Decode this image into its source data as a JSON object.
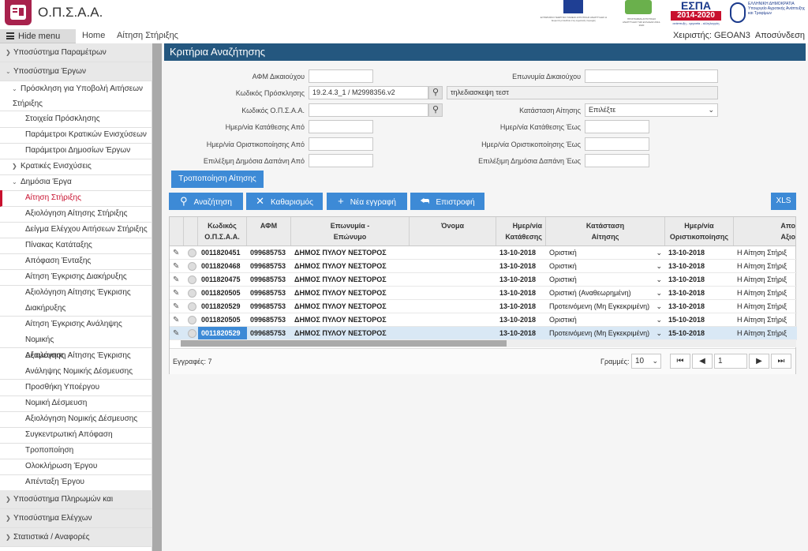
{
  "app": {
    "title": "Ο.Π.Σ.Α.Α."
  },
  "logos": {
    "eu_text": "ΕΥΡΩΠΑΪΚΟ ΓΕΩΡΓΙΚΟ ΤΑΜΕΙΟ ΑΓΡΟΤΙΚΗΣ ΑΝΑΠΤΥΞΗΣ Η Ευρώπη επενδύει στις αγροτικές περιοχές",
    "pad_text": "ΠΡΟΓΡΑΜΜΑ ΑΓΡΟΤΙΚΗΣ ΑΝΑΠΤΥΞΗΣ ΤΗΣ ΕΛΛΑΔΑΣ 2014-2020",
    "espa_title": "ΕΣΠΑ",
    "espa_years": "2014-2020",
    "espa_sub": "ανάπτυξη - εργασία - αλληλεγγύη",
    "gov_text1": "ΕΛΛΗΝΙΚΗ ΔΗΜΟΚΡΑΤΙΑ",
    "gov_text2": "Υπουργείο Αγροτικής Ανάπτυξης",
    "gov_text3": "και Τροφίμων"
  },
  "topnav": {
    "hide_menu": "Hide menu",
    "home": "Home",
    "breadcrumb": "Αίτηση Στήριξης",
    "user_label": "Χειριστής: GEOAN3",
    "logout": "Αποσύνδεση"
  },
  "sidebar": {
    "s1": "Υποσύστημα Παραμέτρων",
    "s2": "Υποσύστημα Έργων",
    "i1a": "Πρόσκληση για Υποβολή Αιτήσεων",
    "i1b": "Στήριξης",
    "i2": "Στοιχεία Πρόσκλησης",
    "i3": "Παράμετροι Κρατικών Ενισχύσεων",
    "i4": "Παράμετροι Δημοσίων Έργων",
    "i5": "Κρατικές Ενισχύσεις",
    "i6": "Δημόσια Έργα",
    "i7": "Αίτηση Στήριξης",
    "i8": "Αξιολόγηση Αίτησης Στήριξης",
    "i9": "Δείγμα Ελέγχου Αιτήσεων Στήριξης",
    "i10": "Πίνακας Κατάταξης",
    "i11": "Απόφαση Ένταξης",
    "i12": "Αίτηση Έγκρισης Διακήρυξης",
    "i13a": "Αξιολόγηση Αίτησης Έγκρισης",
    "i13b": "Διακήρυξης",
    "i14a": "Αίτηση Έγκρισης Ανάληψης Νομικής",
    "i14b": "Δέσμευσης",
    "i15a": "Αξιολόγηση Αίτησης Έγκρισης",
    "i15b": "Ανάληψης Νομικής Δέσμευσης",
    "i16": "Προσθήκη Υποέργου",
    "i17": "Νομική Δέσμευση",
    "i18": "Αξιολόγηση Νομικής Δέσμευσης",
    "i19": "Συγκεντρωτική Απόφαση",
    "i20": "Τροποποίηση",
    "i21": "Ολοκλήρωση Έργου",
    "i22": "Απένταξη Έργου",
    "s3": "Υποσύστημα Πληρωμών και",
    "s4": "Υποσύστημα Ελέγχων",
    "s5": "Στατιστικά / Αναφορές"
  },
  "form": {
    "title": "Κριτήρια Αναζήτησης",
    "afm_label": "ΑΦΜ Δικαιούχου",
    "afm_value": "",
    "surname_label": "Επωνυμία Δικαιούχου",
    "surname_value": "",
    "call_code_label": "Κωδικός Πρόσκλησης",
    "call_code_value": "19.2.4.3_1 / M2998356.v2",
    "call_desc_value": "τηλεδιασκεψη τεστ",
    "opsaa_label": "Κωδικός Ο.Π.Σ.Α.Α.",
    "opsaa_value": "",
    "status_label": "Κατάσταση Αίτησης",
    "status_value": "Επιλέξτε",
    "sub_from_label": "Ημερ/νία Κατάθεσης Από",
    "sub_to_label": "Ημερ/νία Κατάθεσης Έως",
    "fin_from_label": "Ημερ/νία Οριστικοποίησης Από",
    "fin_to_label": "Ημερ/νία Οριστικοποίησης Έως",
    "exp_from_label": "Επιλέξιμη Δημόσια Δαπάνη Από",
    "exp_to_label": "Επιλέξιμη Δημόσια Δαπάνη Έως",
    "modify_btn": "Τροποποίηση Αίτησης"
  },
  "toolbar": {
    "search": "Αναζήτηση",
    "clear": "Καθαρισμός",
    "new": "Νέα εγγραφή",
    "back": "Επιστροφή",
    "xls": "XLS"
  },
  "grid": {
    "headers": {
      "code1": "Κωδικός",
      "code2": "Ο.Π.Σ.Α.Α.",
      "afm": "ΑΦΜ",
      "name1": "Επωνυμία -",
      "name2": "Επώνυμο",
      "first": "Όνομα",
      "sub1": "Ημερ/νία",
      "sub2": "Κατάθεσης",
      "status1": "Κατάσταση",
      "status2": "Αίτησης",
      "fin1": "Ημερ/νία",
      "fin2": "Οριστικοποίησης",
      "dec1": "Απο",
      "dec2": "Αξιο"
    },
    "rows": [
      {
        "code": "0011820451",
        "afm": "099685753",
        "name": "ΔΗΜΟΣ ΠΥΛΟΥ ΝΕΣΤΟΡΟΣ",
        "first": "",
        "sub": "13-10-2018",
        "status": "Οριστική",
        "fin": "13-10-2018",
        "dec": "Η Αίτηση Στήριξ"
      },
      {
        "code": "0011820468",
        "afm": "099685753",
        "name": "ΔΗΜΟΣ ΠΥΛΟΥ ΝΕΣΤΟΡΟΣ",
        "first": "",
        "sub": "13-10-2018",
        "status": "Οριστική",
        "fin": "13-10-2018",
        "dec": "Η Αίτηση Στήριξ"
      },
      {
        "code": "0011820475",
        "afm": "099685753",
        "name": "ΔΗΜΟΣ ΠΥΛΟΥ ΝΕΣΤΟΡΟΣ",
        "first": "",
        "sub": "13-10-2018",
        "status": "Οριστική",
        "fin": "13-10-2018",
        "dec": "Η Αίτηση Στήριξ"
      },
      {
        "code": "0011820505",
        "afm": "099685753",
        "name": "ΔΗΜΟΣ ΠΥΛΟΥ ΝΕΣΤΟΡΟΣ",
        "first": "",
        "sub": "13-10-2018",
        "status": "Οριστική (Αναθεωρημένη)",
        "fin": "13-10-2018",
        "dec": "Η Αίτηση Στήριξ"
      },
      {
        "code": "0011820529",
        "afm": "099685753",
        "name": "ΔΗΜΟΣ ΠΥΛΟΥ ΝΕΣΤΟΡΟΣ",
        "first": "",
        "sub": "13-10-2018",
        "status": "Προτεινόμενη (Μη Εγκεκριμένη)",
        "fin": "13-10-2018",
        "dec": "Η Αίτηση Στήριξ"
      },
      {
        "code": "0011820505",
        "afm": "099685753",
        "name": "ΔΗΜΟΣ ΠΥΛΟΥ ΝΕΣΤΟΡΟΣ",
        "first": "",
        "sub": "13-10-2018",
        "status": "Οριστική",
        "fin": "15-10-2018",
        "dec": "Η Αίτηση Στήριξ"
      },
      {
        "code": "0011820529",
        "afm": "099685753",
        "name": "ΔΗΜΟΣ ΠΥΛΟΥ ΝΕΣΤΟΡΟΣ",
        "first": "",
        "sub": "13-10-2018",
        "status": "Προτεινόμενη (Μη Εγκεκριμένη)",
        "fin": "15-10-2018",
        "dec": "Η Αίτηση Στήριξ"
      }
    ],
    "records_label": "Εγγραφές: 7",
    "rows_label": "Γραμμές:",
    "rows_value": "10",
    "page_value": "1"
  },
  "colors": {
    "header_blue": "#24577f",
    "button_blue": "#3d8ad6",
    "active_red": "#c8102e",
    "logo_magenta": "#a8224d"
  }
}
